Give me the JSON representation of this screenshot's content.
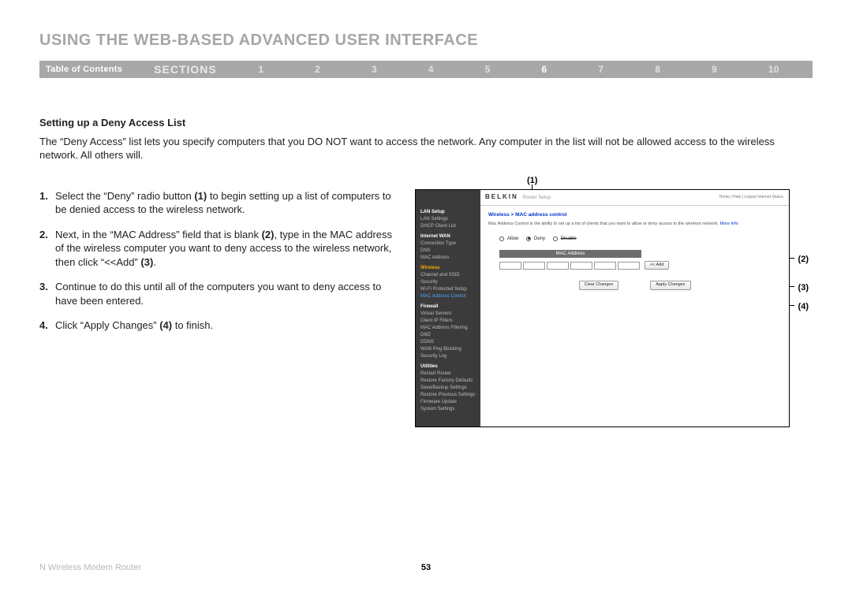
{
  "title": "USING THE WEB-BASED ADVANCED USER INTERFACE",
  "nav": {
    "toc": "Table of Contents",
    "sections_label": "SECTIONS",
    "numbers": [
      "1",
      "2",
      "3",
      "4",
      "5",
      "6",
      "7",
      "8",
      "9",
      "10"
    ],
    "active": "6"
  },
  "section": {
    "heading": "Setting up a Deny Access List",
    "intro": "The “Deny Access” list lets you specify computers that you DO NOT want to access the network. Any computer in the list will not be allowed access to the wireless network. All others will.",
    "steps": [
      "Select the “Deny” radio button (1) to begin setting up a list of computers to be denied access to the wireless network.",
      "Next, in the “MAC Address” field that is blank (2), type in the MAC address of the wireless computer you want to deny access to the wireless network, then click “<<Add” (3).",
      "Continue to do this until all of the computers you want to deny access to have been entered.",
      "Click “Apply Changes” (4) to finish."
    ]
  },
  "callouts": {
    "c1": "(1)",
    "c2": "(2)",
    "c3": "(3)",
    "c4": "(4)"
  },
  "screenshot": {
    "brand": "BELKIN",
    "brand_sub": "Router Setup",
    "toplinks": "Home | Help | Logout   Internet Status:",
    "sidebar": {
      "groups": [
        {
          "header": "LAN Setup",
          "items": [
            "LAN Settings",
            "DHCP Client List"
          ]
        },
        {
          "header": "Internet WAN",
          "items": [
            "Connection Type",
            "DNS",
            "MAC Address"
          ]
        },
        {
          "header_orange": "Wireless",
          "items": [
            "Channel and SSID",
            "Security",
            "Wi-Fi Protected Setup"
          ],
          "active_blue": "MAC Address Control"
        },
        {
          "header": "Firewall",
          "items": [
            "Virtual Servers",
            "Client IP Filters",
            "MAC Address Filtering",
            "DMZ",
            "DDNS",
            "WAN Ping Blocking",
            "Security Log"
          ]
        },
        {
          "header": "Utilities",
          "items": [
            "Restart Router",
            "Restore Factory Defaults",
            "Save/Backup Settings",
            "Restore Previous Settings",
            "Firmware Update",
            "System Settings"
          ]
        }
      ]
    },
    "main": {
      "breadcrumb": "Wireless > MAC address control",
      "desc_pre": "Mac Address Control is the ability to set up a list of clients that you want to allow or deny access to the wireless network. ",
      "desc_link": "More Info",
      "allow": "Allow",
      "deny": "Deny",
      "disable": "Disable",
      "mac_header": "MAC Address",
      "add_btn": "<< Add",
      "clear_btn": "Clear Changes",
      "apply_btn": "Apply Changes"
    }
  },
  "footer": {
    "product": "N Wireless Modem Router",
    "page": "53"
  }
}
